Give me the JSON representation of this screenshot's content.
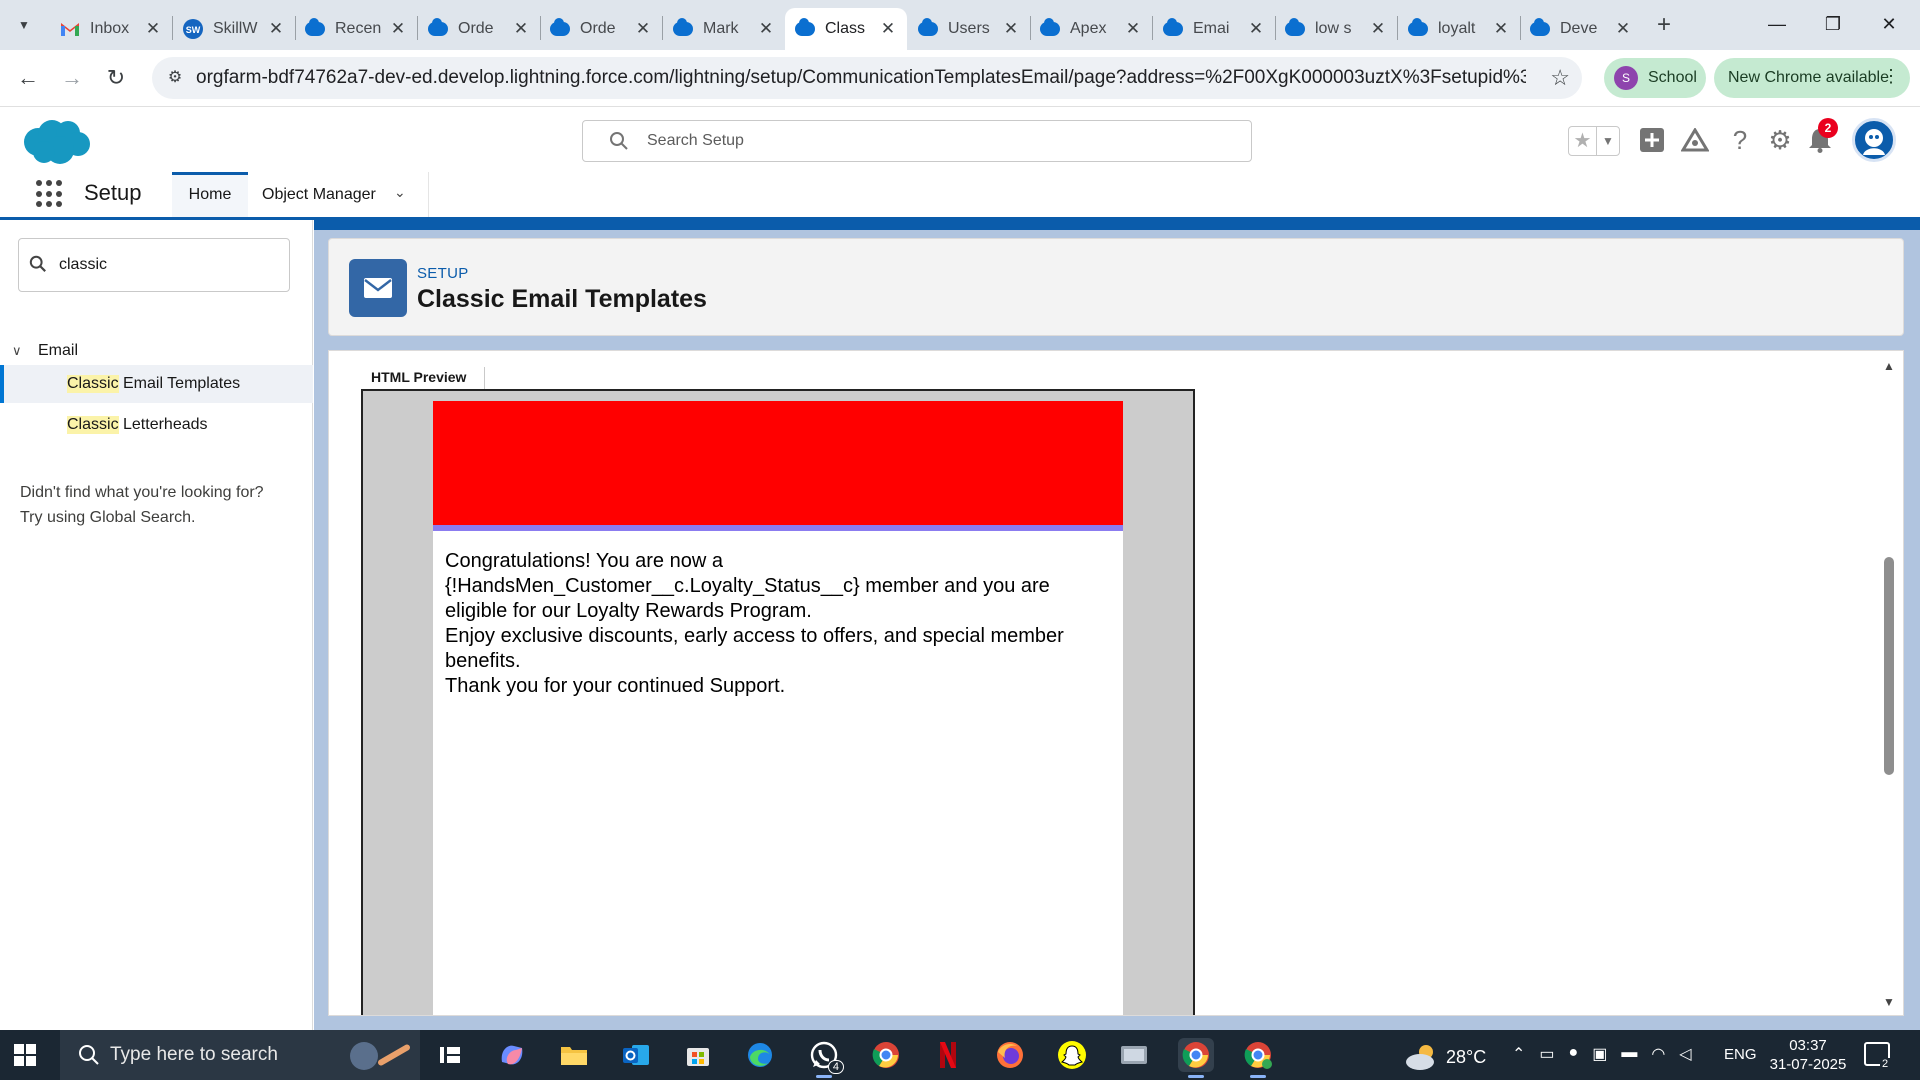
{
  "browser": {
    "tabs": [
      {
        "title": "Inbox",
        "favicon": "gmail-icon"
      },
      {
        "title": "SkillW",
        "favicon": "skillwallet-icon"
      },
      {
        "title": "Recen",
        "favicon": "salesforce-cloud-icon"
      },
      {
        "title": "Orde",
        "favicon": "salesforce-cloud-icon"
      },
      {
        "title": "Orde",
        "favicon": "salesforce-cloud-icon"
      },
      {
        "title": "Mark",
        "favicon": "salesforce-cloud-icon"
      },
      {
        "title": "Class",
        "favicon": "salesforce-cloud-icon",
        "active": true
      },
      {
        "title": "Users",
        "favicon": "salesforce-cloud-icon"
      },
      {
        "title": "Apex",
        "favicon": "salesforce-cloud-icon"
      },
      {
        "title": "Emai",
        "favicon": "salesforce-cloud-icon"
      },
      {
        "title": "low s",
        "favicon": "salesforce-cloud-icon"
      },
      {
        "title": "loyalt",
        "favicon": "salesforce-cloud-icon"
      },
      {
        "title": "Deve",
        "favicon": "salesforce-cloud-icon"
      }
    ],
    "url": "orgfarm-bdf74762a7-dev-ed.develop.lightning.force.com/lightning/setup/CommunicationTemplatesEmail/page?address=%2F00XgK000003uztX%3Fsetupid%3DCommunic...",
    "profile": {
      "initial": "S",
      "name": "School",
      "color": "#8e44ad"
    },
    "update_label": "New Chrome available"
  },
  "sf_header": {
    "search_placeholder": "Search Setup",
    "notification_count": "2",
    "brand_color": "#1798c1"
  },
  "sf_nav": {
    "app_name": "Setup",
    "tabs": [
      {
        "label": "Home",
        "active": true
      },
      {
        "label": "Object Manager"
      }
    ]
  },
  "sidebar": {
    "quickfind_value": "classic",
    "section": "Email",
    "items": [
      {
        "highlight": "Classic",
        "rest": " Email Templates",
        "selected": true
      },
      {
        "highlight": "Classic",
        "rest": " Letterheads"
      }
    ],
    "no_match_line1": "Didn't find what you're looking for?",
    "no_match_line2": "Try using Global Search."
  },
  "page_header": {
    "eyebrow": "SETUP",
    "title": "Classic Email Templates",
    "icon": "email-icon"
  },
  "preview": {
    "tab_label": "HTML Preview",
    "letterhead_color": "#ff0000",
    "accent_line_color": "#8b7cf0",
    "body_lines": [
      "Congratulations! You are now a",
      "{!HandsMen_Customer__c.Loyalty_Status__c} member and you are",
      "eligible for our Loyalty Rewards Program.",
      "Enjoy exclusive discounts, early access to offers, and special member",
      "benefits.",
      "Thank you for your continued Support."
    ]
  },
  "taskbar": {
    "search_placeholder": "Type here to search",
    "apps": [
      "task-view-icon",
      "copilot-icon",
      "file-explorer-icon",
      "outlook-icon",
      "microsoft-store-icon",
      "edge-icon",
      "whatsapp-icon",
      "chrome-profile-icon",
      "netflix-icon",
      "firefox-icon",
      "snapchat-icon",
      "media-icon",
      "chrome-icon",
      "chrome-alt-icon"
    ],
    "whatsapp_badge": "4",
    "temperature": "28°C",
    "language": "ENG",
    "time": "03:37",
    "date": "31-07-2025",
    "notification_count": "2"
  }
}
